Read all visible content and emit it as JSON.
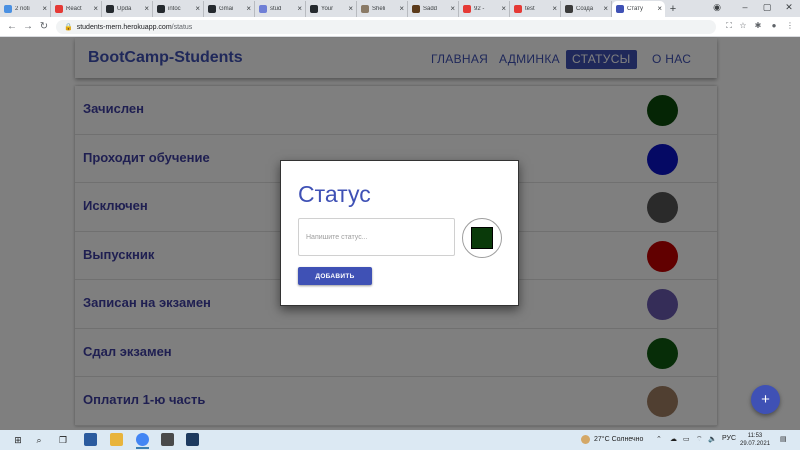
{
  "browser": {
    "tabs": [
      {
        "label": "2 noti",
        "favicon_color": "#4a90e2"
      },
      {
        "label": "React",
        "favicon_color": "#e53935"
      },
      {
        "label": "Upda",
        "favicon_color": "#24292e"
      },
      {
        "label": "intoc",
        "favicon_color": "#24292e"
      },
      {
        "label": "Gmai",
        "favicon_color": "#24292e"
      },
      {
        "label": "stud",
        "favicon_color": "#6f7fd6"
      },
      {
        "label": "Your",
        "favicon_color": "#24292e"
      },
      {
        "label": "Sheli",
        "favicon_color": "#8a7a66"
      },
      {
        "label": "Sadd",
        "favicon_color": "#5b3a1a"
      },
      {
        "label": "92 -",
        "favicon_color": "#e53935"
      },
      {
        "label": "test",
        "favicon_color": "#e53935"
      },
      {
        "label": "Созда",
        "favicon_color": "#3a3a3a"
      },
      {
        "label": "Стату",
        "favicon_color": "#3f51b5",
        "active": true
      }
    ],
    "new_tab_symbol": "+",
    "url_domain": "students-mern.herokuapp.com",
    "url_path": "/status"
  },
  "header": {
    "brand": "BootCamp-Students",
    "nav": [
      {
        "label": "ГЛАВНАЯ",
        "active": false
      },
      {
        "label": "АДМИНКА",
        "active": false
      },
      {
        "label": "СТАТУСЫ",
        "active": true
      },
      {
        "label": "О НАС",
        "active": false
      }
    ]
  },
  "statuses": [
    {
      "name": "Зачислен",
      "color": "#0b4a0b"
    },
    {
      "name": "Проходит обучение",
      "color": "#0a12c8"
    },
    {
      "name": "Исключен",
      "color": "#555555"
    },
    {
      "name": "Выпускник",
      "color": "#c20000"
    },
    {
      "name": "Записан на экзамен",
      "color": "#6a5ab0"
    },
    {
      "name": "Сдал экзамен",
      "color": "#0e5a10"
    },
    {
      "name": "Оплатил 1-ю часть",
      "color": "#a07e63"
    }
  ],
  "fab": {
    "symbol": "+"
  },
  "modal": {
    "title": "Статус",
    "input_placeholder": "Напишите статус...",
    "input_value": "",
    "selected_color": "#0a3a0a",
    "add_button": "ДОБАВИТЬ"
  },
  "taskbar": {
    "weather": "27°C  Солнечно",
    "language": "РУС",
    "time": "11:53",
    "date": "29.07.2021"
  },
  "colors": {
    "primary": "#3f51b5",
    "overlay": "rgba(0,0,0,0.5)"
  }
}
